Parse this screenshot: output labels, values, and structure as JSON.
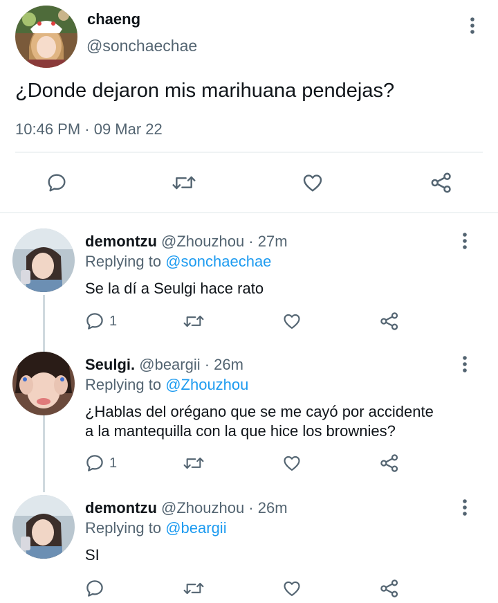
{
  "colors": {
    "accent": "#1d9bf0",
    "muted": "#536471",
    "divider": "#eff3f4",
    "thread": "#cfd9de"
  },
  "main_tweet": {
    "display_name": "chaeng",
    "handle": "@sonchaechae",
    "text": "¿Donde dejaron mis marihuana pendejas?",
    "timestamp": "10:46 PM · 09 Mar 22"
  },
  "replies": [
    {
      "display_name": "demontzu",
      "handle_time": "@Zhouzhou · 27m",
      "replying_prefix": "Replying to",
      "replying_to": "@sonchaechae",
      "text": "Se la dí a Seulgi hace rato",
      "reply_count": "1"
    },
    {
      "display_name": "Seulgi.",
      "handle_time": "@beargii · 26m",
      "replying_prefix": "Replying to",
      "replying_to": "@Zhouzhou",
      "text_line1": "¿Hablas del orégano que se me cayó por accidente",
      "text_line2": "a la mantequilla con la que hice los brownies?",
      "reply_count": "1"
    },
    {
      "display_name": "demontzu",
      "handle_time": "@Zhouzhou · 26m",
      "replying_prefix": "Replying to",
      "replying_to": "@beargii",
      "text": "SI",
      "reply_count": ""
    }
  ],
  "icons": [
    "reply-icon",
    "retweet-icon",
    "like-icon",
    "share-icon",
    "more-icon"
  ]
}
